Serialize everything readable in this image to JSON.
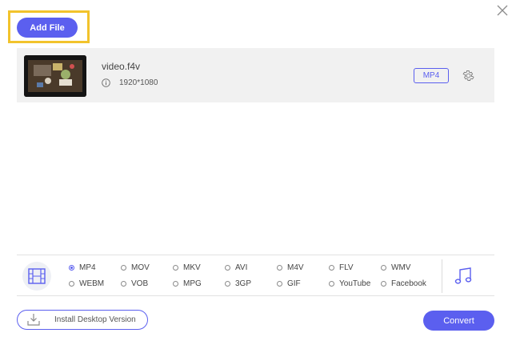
{
  "toolbar": {
    "add_file_label": "Add File"
  },
  "file": {
    "name": "video.f4v",
    "resolution": "1920*1080",
    "output_format": "MP4"
  },
  "formats": {
    "selected": "MP4",
    "row1": [
      "MP4",
      "MOV",
      "MKV",
      "AVI",
      "M4V",
      "FLV",
      "WMV"
    ],
    "row2": [
      "WEBM",
      "VOB",
      "MPG",
      "3GP",
      "GIF",
      "YouTube",
      "Facebook"
    ]
  },
  "footer": {
    "install_label": "Install Desktop Version",
    "convert_label": "Convert"
  },
  "colors": {
    "accent": "#5b5fef",
    "highlight": "#f2c32c",
    "row_bg": "#f1f1f1"
  }
}
